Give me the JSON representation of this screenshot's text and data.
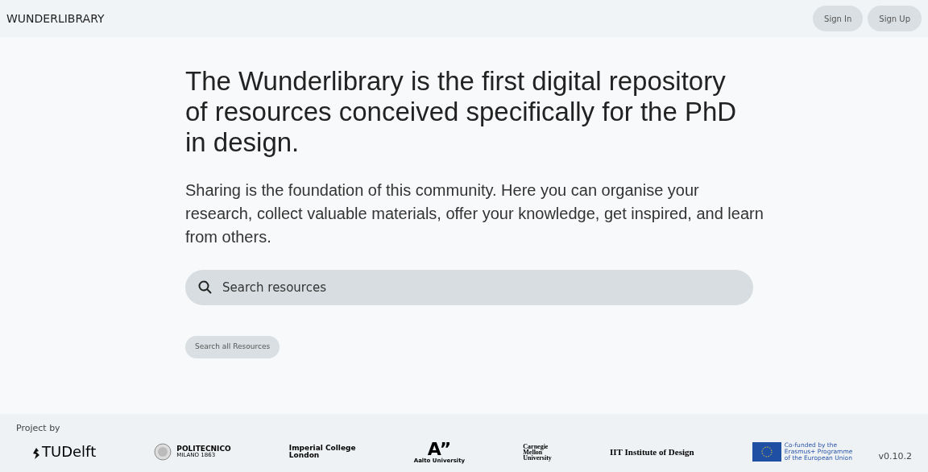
{
  "header": {
    "brand": "WUNDERLIBRARY",
    "buttons": [
      "Sign In",
      "Sign Up"
    ]
  },
  "hero": {
    "title": "The Wunderlibrary is the first digital repository of resources conceived specifically for the PhD in design.",
    "intro": "Sharing is the foundation of this community. Here you can organise your research, collect valuable materials, offer your knowledge, get inspired, and learn from others.",
    "search": {
      "placeholder": "Search resources"
    },
    "button": "Search all Resources"
  },
  "footer": {
    "label": "Project by",
    "partners": [
      {
        "kind": "tudelft",
        "lines": [
          "TUDelft"
        ]
      },
      {
        "kind": "polimi",
        "lines": [
          "POLITECNICO",
          "MILANO 1863"
        ]
      },
      {
        "kind": "imperial",
        "lines": [
          "Imperial College",
          "London"
        ]
      },
      {
        "kind": "aalto",
        "lines": [
          "A”",
          "Aalto University"
        ]
      },
      {
        "kind": "cmu",
        "lines": [
          "Carnegie",
          "Mellon",
          "University"
        ]
      },
      {
        "kind": "iit",
        "lines": [
          "IIT Institute of Design"
        ]
      },
      {
        "kind": "eu",
        "lines": [
          "Co-funded by the",
          "Erasmus+ Programme",
          "of the European Union"
        ]
      }
    ],
    "version": "v0.10.2"
  }
}
